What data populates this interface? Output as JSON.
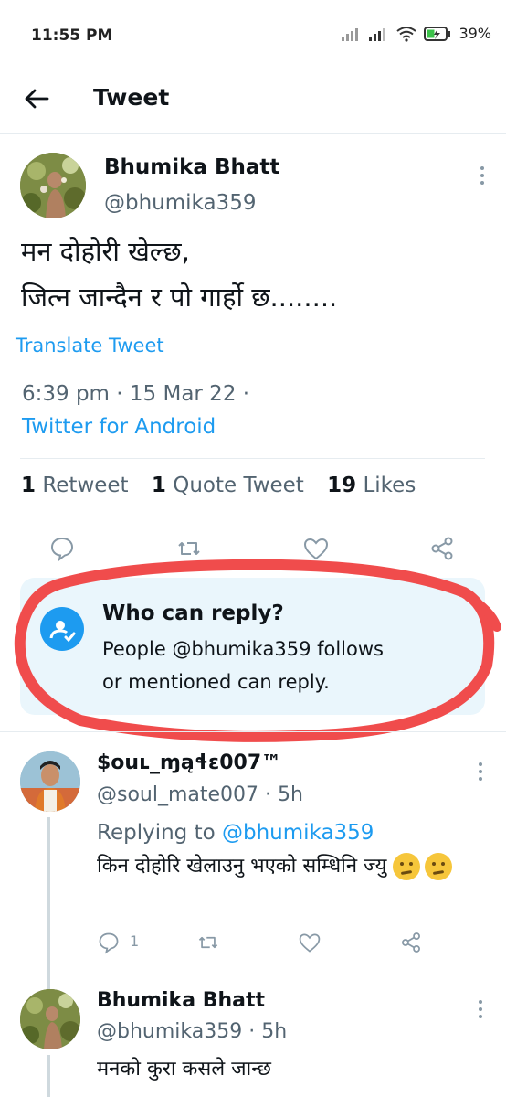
{
  "status_bar": {
    "time": "11:55 PM",
    "battery": "39%"
  },
  "header": {
    "title": "Tweet"
  },
  "tweet": {
    "author_name": "Bhumika Bhatt",
    "author_handle": "@bhumika359",
    "text_line1": "मन दोहोरी खेल्छ,",
    "text_line2": "जित्न जान्दैन र पो गार्हो छ........",
    "translate_label": "Translate Tweet",
    "timestamp": "6:39 pm · 15 Mar 22 ·",
    "source": "Twitter for Android",
    "retweets_count": "1",
    "retweets_label": " Retweet",
    "quotes_count": "1",
    "quotes_label": " Quote Tweet",
    "likes_count": "19",
    "likes_label": " Likes"
  },
  "who_can_reply": {
    "title": "Who can reply?",
    "line1": "People @bhumika359 follows",
    "line2": "or mentioned can reply."
  },
  "reply1": {
    "author_name": "$ouʟ_ɱąɬɛ007™",
    "author_handle": "@soul_mate007",
    "time": " · 5h",
    "replying_to_label": "Replying to ",
    "replying_to_handle": "@bhumika359",
    "text": "किन दोहोरि खेलाउनु भएको सम्धिनि ज्यु",
    "reply_count": "1"
  },
  "reply2": {
    "author_name": "Bhumika Bhatt",
    "author_handle": "@bhumika359",
    "time": " · 5h",
    "text": "मनको कुरा कसले जान्छ"
  },
  "colors": {
    "accent": "#1d9bf0",
    "annotation_ring": "#f04c4c",
    "reply_box_bg": "#eaf6fc"
  },
  "icons": [
    "back-arrow-icon",
    "kebab-icon",
    "reply-icon",
    "retweet-icon",
    "like-icon",
    "share-icon",
    "shield-person-icon",
    "thinking-face-emoji"
  ]
}
